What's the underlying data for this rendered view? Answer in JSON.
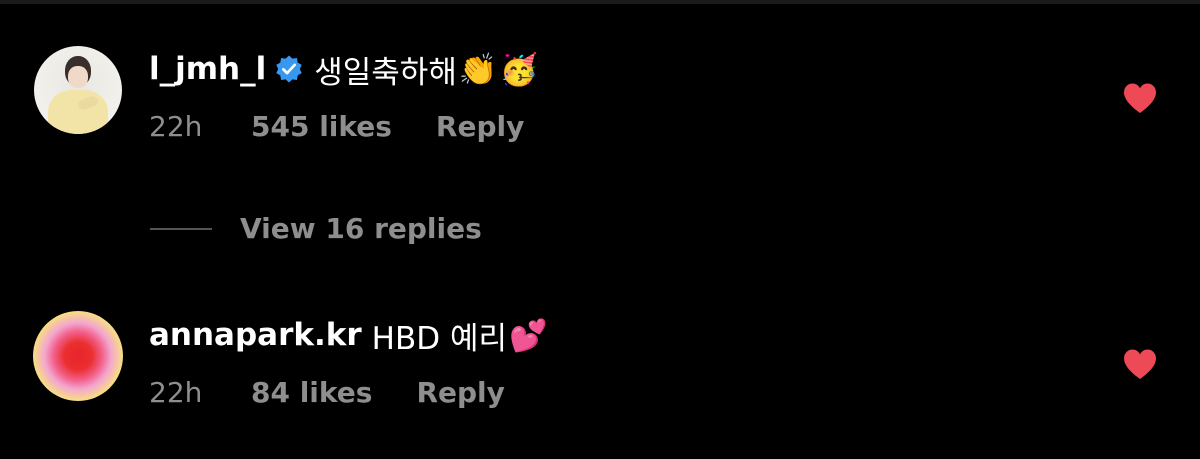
{
  "colors": {
    "background": "#000000",
    "text_primary": "#ffffff",
    "text_secondary": "#8e8e8e",
    "verified_badge": "#3897f0",
    "heart": "#ed4956"
  },
  "comments": [
    {
      "username": "l_jmh_l",
      "verified": true,
      "text": "생일축하해",
      "emojis": [
        "👏",
        "🥳"
      ],
      "time": "22h",
      "likes": "545 likes",
      "reply_label": "Reply",
      "liked": true,
      "avatar": "person-photo"
    },
    {
      "username": "annapark.kr",
      "verified": false,
      "text": "HBD 예리",
      "emojis": [
        "💕"
      ],
      "time": "22h",
      "likes": "84 likes",
      "reply_label": "Reply",
      "liked": true,
      "avatar": "gradient-aura"
    }
  ],
  "view_replies": {
    "label": "View 16 replies"
  },
  "icons": {
    "verified": "verified-badge-icon",
    "like": "heart-icon"
  }
}
